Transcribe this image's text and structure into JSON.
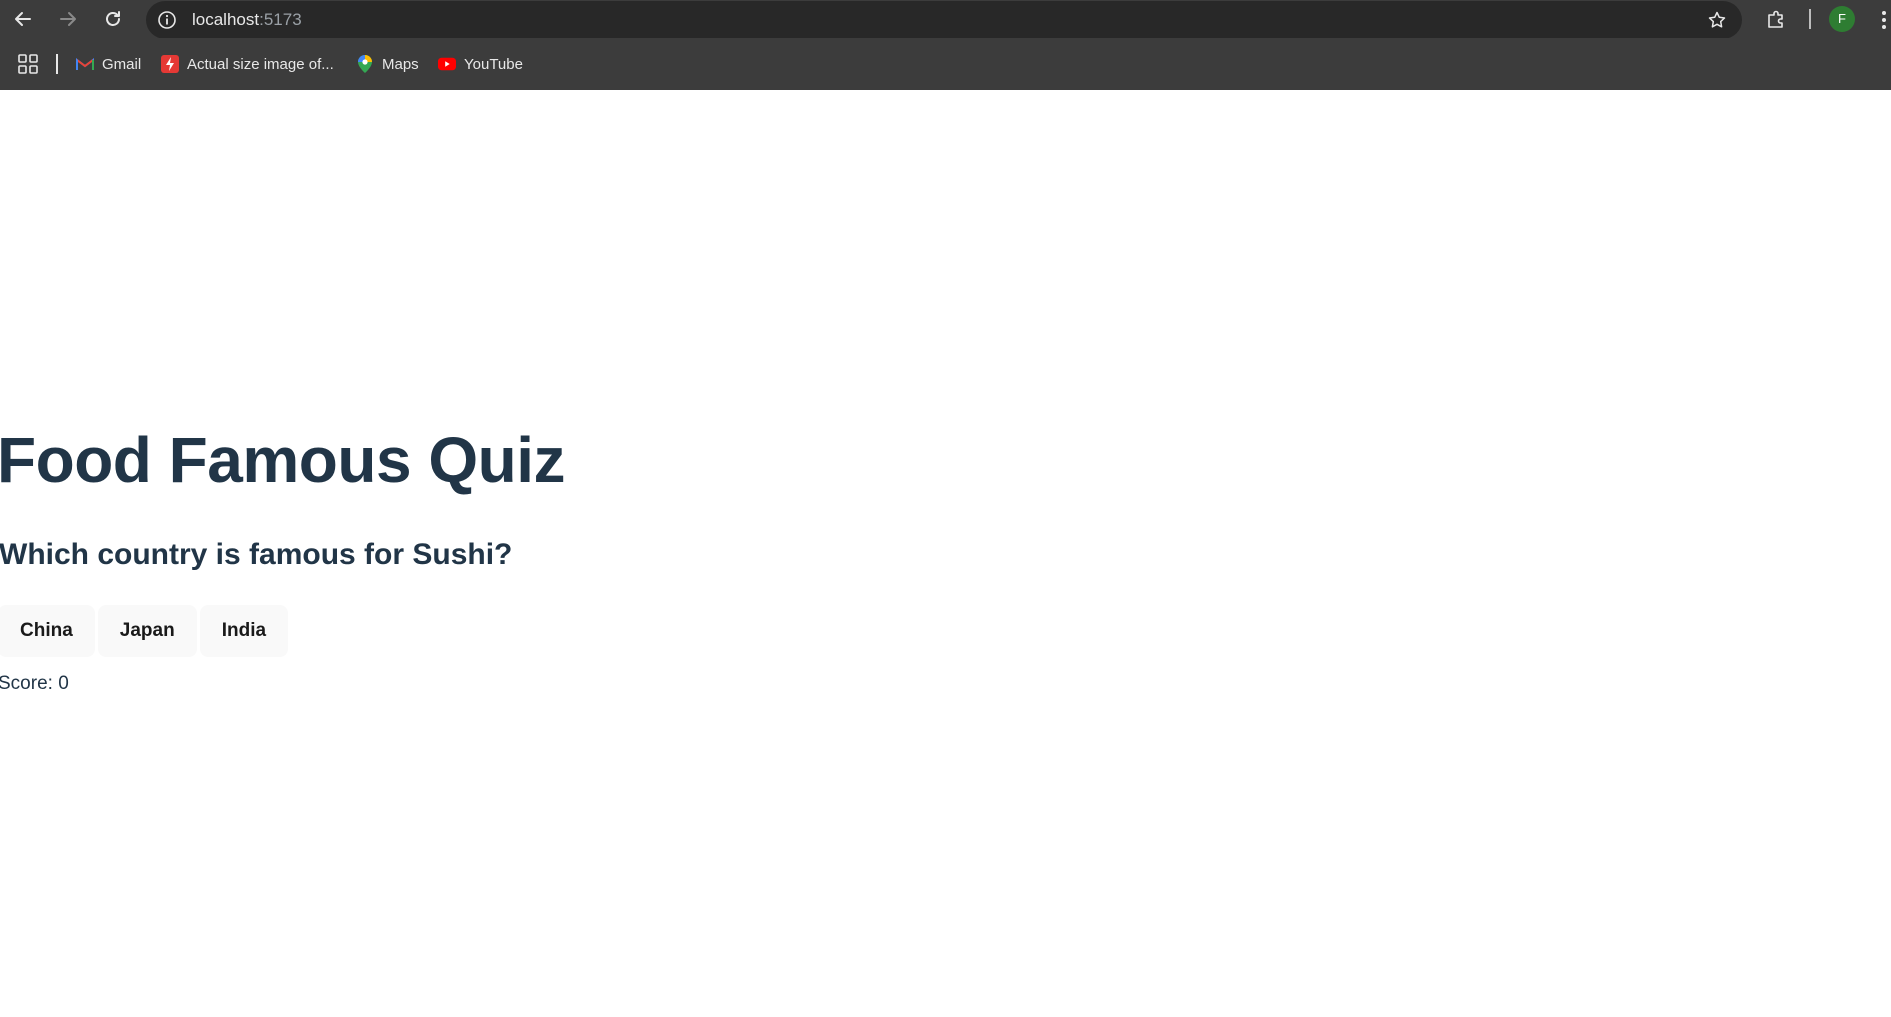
{
  "browser": {
    "url_host": "localhost",
    "url_port": ":5173",
    "avatar_letter": "F",
    "icons": {
      "back": "arrow-left-icon",
      "forward": "arrow-right-icon",
      "reload": "reload-icon",
      "site_info": "info-icon",
      "bookmark_star": "star-icon",
      "extensions": "puzzle-icon",
      "menu": "kebab-menu-icon",
      "apps": "apps-grid-icon"
    },
    "bookmarks": [
      {
        "label": "Gmail",
        "icon": "gmail-icon"
      },
      {
        "label": "Actual size image of...",
        "icon": "bolt-icon"
      },
      {
        "label": "Maps",
        "icon": "maps-pin-icon"
      },
      {
        "label": "YouTube",
        "icon": "youtube-icon"
      }
    ]
  },
  "quiz": {
    "title": "Food Famous Quiz",
    "question": "Which country is famous for Sushi?",
    "options": [
      "China",
      "Japan",
      "India"
    ],
    "score_text": "Score: 0"
  },
  "colors": {
    "heading": "#213547",
    "button_bg": "#f9f9f9",
    "chrome_bg": "#3c3c3c",
    "omnibox_bg": "#282828"
  }
}
